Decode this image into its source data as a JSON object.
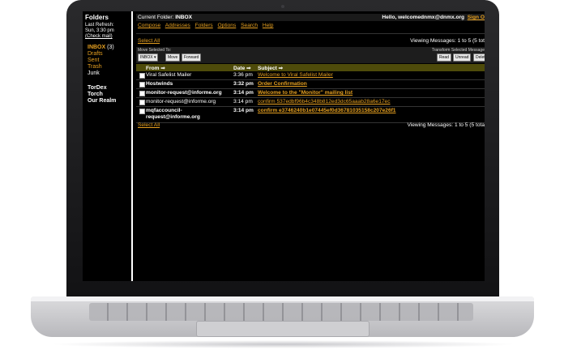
{
  "sidebar": {
    "title": "Folders",
    "last_refresh_label": "Last Refresh:",
    "last_refresh_time": "Sun, 3:30 pm",
    "check_mail": "(Check mail)",
    "folders": [
      {
        "label": "INBOX",
        "count": "(3)"
      },
      {
        "label": "Drafts"
      },
      {
        "label": "Sent"
      },
      {
        "label": "Trash"
      },
      {
        "label": "Junk"
      }
    ],
    "plugins": [
      "TorDex",
      "Torch",
      "Our Realm"
    ]
  },
  "header": {
    "current_folder_label": "Current Folder:",
    "current_folder": "INBOX",
    "greeting": "Hello, welcomednmx@dnmx.org",
    "sign_out": "Sign O"
  },
  "menu": [
    "Compose",
    "Addresses",
    "Folders",
    "Options",
    "Search",
    "Help"
  ],
  "list": {
    "select_all": "Select All",
    "viewing_top": "Viewing Messages: 1 to 5 (5 tot",
    "viewing_bottom": "Viewing Messages: 1 to 5 (5 tota",
    "move_label": "Move Selected To:",
    "move_target": "INBOX",
    "move_button": "Move",
    "forward_button": "Forward",
    "transform_label": "Transform Selected Message",
    "read_button": "Read",
    "unread_button": "Unread",
    "delete_button": "Delet",
    "columns": {
      "from": "From ⇒",
      "date": "Date ⇒",
      "subject": "Subject ⇒"
    },
    "rows": [
      {
        "from": "Viral Safelist Mailer",
        "date": "3:36 pm",
        "subject": "Welcome to Viral Safelist Mailer",
        "unread": false
      },
      {
        "from": "Hostwinds",
        "date": "3:32 pm",
        "subject": "Order Confirmation",
        "unread": true
      },
      {
        "from": "monitor-request@informe.org",
        "date": "3:14 pm",
        "subject": "Welcome to the \"Monitor\" mailing list",
        "unread": true
      },
      {
        "from": "monitor-request@informe.org",
        "date": "3:14 pm",
        "subject": "confirm 537edbf96b4c348b812ed3dc65aaab28a6e17ec",
        "unread": false
      },
      {
        "from": "mqfaccouncil-request@informe.org",
        "from_line1": "mqfaccouncil-",
        "from_line2": "request@informe.org",
        "date": "3:14 pm",
        "subject": "confirm e3746240b1e07445ef0d36781035158c207e26f1",
        "unread": true
      }
    ]
  }
}
